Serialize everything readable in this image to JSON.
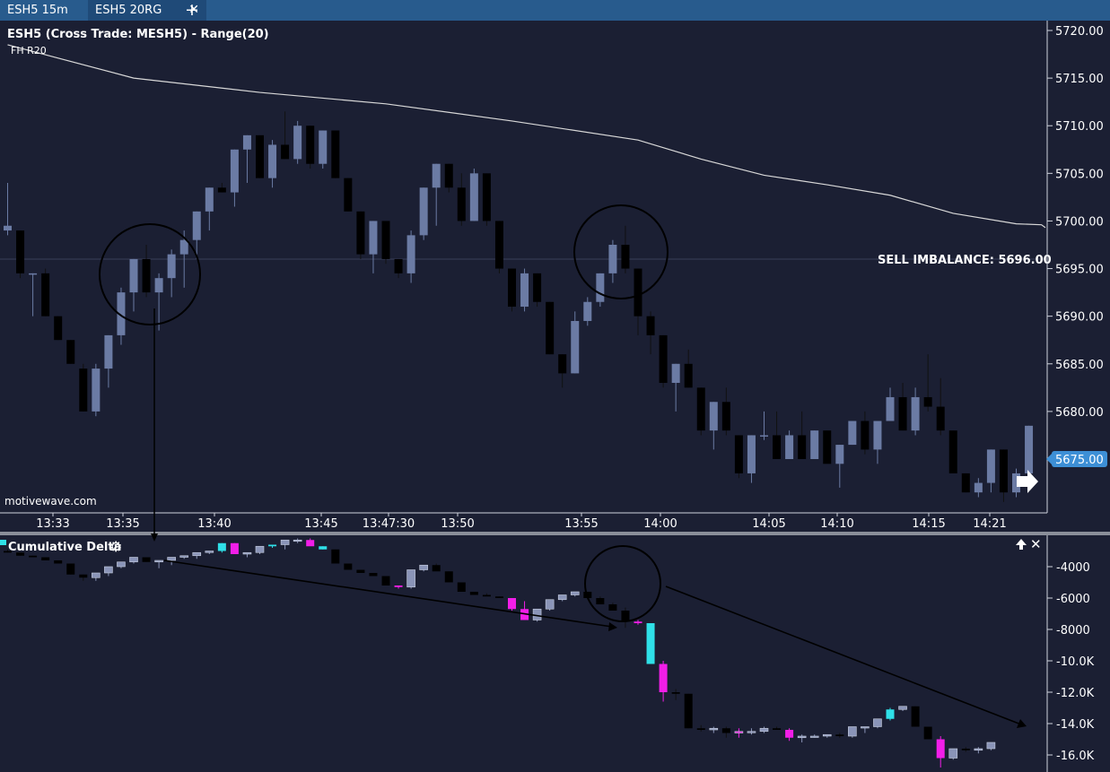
{
  "tabs": [
    {
      "label": "ESH5 15m",
      "active": false
    },
    {
      "label": "ESH5 20RG",
      "active": true
    }
  ],
  "add_tab_icon": "plus-icon",
  "close_tab_icon": "close-icon",
  "main": {
    "title": "ESH5 (Cross Trade: MESH5) - Range(20)",
    "subtitle": "FH R20",
    "watermark": "motivewave.com",
    "annotation": "SELL IMBALANCE: 5696.00",
    "current_price": "5675.00",
    "price_axis": [
      "5720.00",
      "5715.00",
      "5710.00",
      "5705.00",
      "5700.00",
      "5695.00",
      "5690.00",
      "5685.00",
      "5680.00",
      "5675.00"
    ],
    "time_axis": [
      "13:33",
      "13:35",
      "13:40",
      "13:45",
      "13:47:30",
      "13:50",
      "13:55",
      "14:00",
      "14:05",
      "14:10",
      "14:15",
      "14:21"
    ]
  },
  "lower": {
    "title": "Cumulative Delta",
    "settings_icon": "gear-icon",
    "maximize_icon": "arrow-up-icon",
    "close_icon": "close-icon",
    "axis": [
      "-4000",
      "-6000",
      "-8000",
      "-10.0K",
      "-12.0K",
      "-14.0K",
      "-16.0K"
    ]
  },
  "colors": {
    "background": "#1b1f33",
    "up_candle": "#6b7ba4",
    "down_candle": "#000000",
    "delta_up": "#2fe0e8",
    "delta_down": "#f21ee8",
    "vwap_line": "#d8d8d8",
    "price_badge": "#3d8fd6"
  },
  "chart_data": [
    {
      "type": "candlestick",
      "title": "ESH5 (Cross Trade: MESH5) - Range(20)",
      "y_range": [
        5670,
        5722
      ],
      "x_labels": [
        "13:33",
        "13:35",
        "13:40",
        "13:45",
        "13:47:30",
        "13:50",
        "13:55",
        "14:00",
        "14:05",
        "14:10",
        "14:15",
        "14:21"
      ],
      "ohlc": [
        [
          5699.0,
          5704.0,
          5698.5,
          5699.5
        ],
        [
          5699.0,
          5699.0,
          5694.0,
          5694.5
        ],
        [
          5694.5,
          5694.5,
          5690.0,
          5694.5
        ],
        [
          5694.5,
          5695.0,
          5690.0,
          5690.0
        ],
        [
          5690.0,
          5690.0,
          5687.5,
          5687.5
        ],
        [
          5687.5,
          5687.5,
          5685.0,
          5685.0
        ],
        [
          5684.5,
          5685.0,
          5680.0,
          5680.0
        ],
        [
          5680.0,
          5685.0,
          5679.5,
          5684.5
        ],
        [
          5684.5,
          5688.0,
          5682.5,
          5688.0
        ],
        [
          5688.0,
          5693.0,
          5687.0,
          5692.5
        ],
        [
          5692.5,
          5696.0,
          5690.5,
          5696.0
        ],
        [
          5696.0,
          5697.5,
          5692.0,
          5692.5
        ],
        [
          5692.5,
          5694.5,
          5688.5,
          5694.0
        ],
        [
          5694.0,
          5697.0,
          5692.0,
          5696.5
        ],
        [
          5696.5,
          5699.0,
          5693.0,
          5698.0
        ],
        [
          5698.0,
          5701.0,
          5696.0,
          5701.0
        ],
        [
          5701.0,
          5703.5,
          5699.0,
          5703.5
        ],
        [
          5703.5,
          5704.0,
          5703.0,
          5703.0
        ],
        [
          5703.0,
          5707.5,
          5701.5,
          5707.5
        ],
        [
          5707.5,
          5709.0,
          5704.0,
          5709.0
        ],
        [
          5709.0,
          5709.0,
          5704.5,
          5704.5
        ],
        [
          5704.5,
          5708.5,
          5703.5,
          5708.0
        ],
        [
          5708.0,
          5711.5,
          5706.5,
          5706.5
        ],
        [
          5706.5,
          5710.5,
          5706.0,
          5710.0
        ],
        [
          5710.0,
          5710.0,
          5705.5,
          5706.0
        ],
        [
          5706.0,
          5709.5,
          5705.5,
          5709.5
        ],
        [
          5709.5,
          5709.5,
          5704.5,
          5704.5
        ],
        [
          5704.5,
          5704.5,
          5701.0,
          5701.0
        ],
        [
          5701.0,
          5701.0,
          5696.0,
          5696.5
        ],
        [
          5696.5,
          5700.0,
          5694.5,
          5700.0
        ],
        [
          5700.0,
          5700.0,
          5695.5,
          5696.0
        ],
        [
          5696.0,
          5696.0,
          5694.0,
          5694.5
        ],
        [
          5694.5,
          5699.0,
          5693.5,
          5698.5
        ],
        [
          5698.5,
          5703.5,
          5698.0,
          5703.5
        ],
        [
          5703.5,
          5706.0,
          5699.5,
          5706.0
        ],
        [
          5706.0,
          5706.0,
          5703.0,
          5703.5
        ],
        [
          5703.5,
          5705.0,
          5699.5,
          5700.0
        ],
        [
          5700.0,
          5705.5,
          5700.0,
          5705.0
        ],
        [
          5705.0,
          5705.0,
          5699.5,
          5700.0
        ],
        [
          5700.0,
          5700.0,
          5694.5,
          5695.0
        ],
        [
          5695.0,
          5695.0,
          5690.5,
          5691.0
        ],
        [
          5691.0,
          5695.0,
          5690.5,
          5694.5
        ],
        [
          5694.5,
          5694.5,
          5691.0,
          5691.5
        ],
        [
          5691.5,
          5691.5,
          5686.0,
          5686.0
        ],
        [
          5686.0,
          5686.0,
          5682.5,
          5684.0
        ],
        [
          5684.0,
          5690.5,
          5684.0,
          5689.5
        ],
        [
          5689.5,
          5692.0,
          5689.0,
          5691.5
        ],
        [
          5691.5,
          5694.5,
          5691.0,
          5694.5
        ],
        [
          5694.5,
          5698.0,
          5693.5,
          5697.5
        ],
        [
          5697.5,
          5699.5,
          5694.5,
          5695.0
        ],
        [
          5695.0,
          5695.0,
          5688.0,
          5690.0
        ],
        [
          5690.0,
          5690.5,
          5686.0,
          5688.0
        ],
        [
          5688.0,
          5688.0,
          5682.5,
          5683.0
        ],
        [
          5683.0,
          5685.0,
          5680.0,
          5685.0
        ],
        [
          5685.0,
          5686.5,
          5682.5,
          5682.5
        ],
        [
          5682.5,
          5682.5,
          5677.5,
          5678.0
        ],
        [
          5678.0,
          5681.0,
          5676.0,
          5681.0
        ],
        [
          5681.0,
          5682.5,
          5677.5,
          5678.0
        ],
        [
          5677.5,
          5677.5,
          5673.0,
          5673.5
        ],
        [
          5673.5,
          5677.5,
          5672.5,
          5677.5
        ],
        [
          5677.5,
          5680.0,
          5677.0,
          5677.5
        ],
        [
          5677.5,
          5680.0,
          5676.5,
          5675.0
        ],
        [
          5675.0,
          5678.0,
          5675.0,
          5677.5
        ],
        [
          5677.5,
          5680.0,
          5675.0,
          5675.0
        ],
        [
          5675.0,
          5678.0,
          5675.0,
          5678.0
        ],
        [
          5678.0,
          5678.0,
          5675.0,
          5674.5
        ],
        [
          5674.5,
          5676.5,
          5672.0,
          5676.5
        ],
        [
          5676.5,
          5679.0,
          5676.5,
          5679.0
        ],
        [
          5679.0,
          5680.0,
          5675.5,
          5676.0
        ],
        [
          5676.0,
          5679.0,
          5674.5,
          5679.0
        ],
        [
          5679.0,
          5682.5,
          5679.0,
          5681.5
        ],
        [
          5681.5,
          5683.0,
          5678.0,
          5678.0
        ],
        [
          5678.0,
          5682.5,
          5677.5,
          5681.5
        ],
        [
          5681.5,
          5686.0,
          5680.0,
          5680.5
        ],
        [
          5680.5,
          5683.5,
          5677.5,
          5678.0
        ],
        [
          5678.0,
          5678.0,
          5675.5,
          5673.5
        ],
        [
          5673.5,
          5673.5,
          5671.5,
          5671.5
        ],
        [
          5671.5,
          5673.0,
          5671.0,
          5672.5
        ],
        [
          5672.5,
          5676.0,
          5671.5,
          5676.0
        ],
        [
          5676.0,
          5676.0,
          5670.5,
          5671.5
        ],
        [
          5671.5,
          5674.0,
          5671.0,
          5673.5
        ],
        [
          5673.5,
          5678.5,
          5673.0,
          5678.5
        ]
      ],
      "vwap": [
        [
          0,
          5718.5
        ],
        [
          10,
          5715.0
        ],
        [
          20,
          5713.5
        ],
        [
          30,
          5712.3
        ],
        [
          40,
          5710.5
        ],
        [
          50,
          5708.5
        ],
        [
          55,
          5706.5
        ],
        [
          60,
          5704.8
        ],
        [
          65,
          5703.8
        ],
        [
          70,
          5702.7
        ],
        [
          75,
          5700.8
        ],
        [
          80,
          5699.7
        ],
        [
          82,
          5699.6
        ]
      ],
      "annotations": [
        {
          "text": "SELL IMBALANCE: 5696.00",
          "price": 5696.0
        }
      ]
    },
    {
      "type": "candlestick",
      "title": "Cumulative Delta",
      "y_range": [
        -17000,
        -2800
      ],
      "ohlc": [
        [
          -3000,
          -2900,
          -3100,
          -3100
        ],
        [
          -3100,
          -3100,
          -3300,
          -3300
        ],
        [
          -3300,
          -3300,
          -3400,
          -3400
        ],
        [
          -3400,
          -3400,
          -3600,
          -3600
        ],
        [
          -3600,
          -3600,
          -3800,
          -3800
        ],
        [
          -3800,
          -3800,
          -4500,
          -4500
        ],
        [
          -4500,
          -4500,
          -4900,
          -4700
        ],
        [
          -4700,
          -4700,
          -4900,
          -4400
        ],
        [
          -4400,
          -4300,
          -4600,
          -4000
        ],
        [
          -4000,
          -3900,
          -4100,
          -3700
        ],
        [
          -3700,
          -3600,
          -3800,
          -3400
        ],
        [
          -3400,
          -3400,
          -3700,
          -3700
        ],
        [
          -3700,
          -3600,
          -4100,
          -3600
        ],
        [
          -3600,
          -3400,
          -3900,
          -3400
        ],
        [
          -3400,
          -3300,
          -3500,
          -3300
        ],
        [
          -3300,
          -3200,
          -3500,
          -3100
        ],
        [
          -3100,
          -3000,
          -3200,
          -3000
        ],
        [
          -3000,
          -2500,
          -3100,
          -2500
        ],
        [
          -2500,
          -2500,
          -3100,
          -3200
        ],
        [
          -3200,
          -3200,
          -3400,
          -3100
        ],
        [
          -3100,
          -2900,
          -3200,
          -2700
        ],
        [
          -2700,
          -2600,
          -2800,
          -2600
        ],
        [
          -2600,
          -2400,
          -2900,
          -2300
        ],
        [
          -2300,
          -2200,
          -2500,
          -2300
        ],
        [
          -2300,
          -2200,
          -2500,
          -2700
        ],
        [
          -2700,
          -2700,
          -2900,
          -2900
        ],
        [
          -2900,
          -2900,
          -3800,
          -3800
        ],
        [
          -3800,
          -3800,
          -4200,
          -4200
        ],
        [
          -4200,
          -4200,
          -4400,
          -4400
        ],
        [
          -4400,
          -4400,
          -4600,
          -4600
        ],
        [
          -4600,
          -4600,
          -5200,
          -5200
        ],
        [
          -5200,
          -5200,
          -5400,
          -5300
        ],
        [
          -5300,
          -5200,
          -5400,
          -4200
        ],
        [
          -4200,
          -4000,
          -4300,
          -3900
        ],
        [
          -3900,
          -3800,
          -4000,
          -4300
        ],
        [
          -4300,
          -4300,
          -5000,
          -5000
        ],
        [
          -5000,
          -5000,
          -5600,
          -5600
        ],
        [
          -5600,
          -5600,
          -5800,
          -5800
        ],
        [
          -5800,
          -5700,
          -5800,
          -5900
        ],
        [
          -5900,
          -5900,
          -6000,
          -6000
        ],
        [
          -6000,
          -6000,
          -6800,
          -6700
        ],
        [
          -6700,
          -6200,
          -7400,
          -7400
        ],
        [
          -7400,
          -7300,
          -7500,
          -6700
        ],
        [
          -6700,
          -6100,
          -6800,
          -6100
        ],
        [
          -6100,
          -5800,
          -6200,
          -5800
        ],
        [
          -5800,
          -5600,
          -5900,
          -5600
        ],
        [
          -5600,
          -5600,
          -6100,
          -6000
        ],
        [
          -6000,
          -5900,
          -6400,
          -6400
        ],
        [
          -6400,
          -6300,
          -6800,
          -6800
        ],
        [
          -6800,
          -6600,
          -7900,
          -7500
        ],
        [
          -7500,
          -7400,
          -7700,
          -7600
        ],
        [
          -7600,
          -7600,
          -10200,
          -10200
        ],
        [
          -10200,
          -10000,
          -12600,
          -12000
        ],
        [
          -12000,
          -11800,
          -12500,
          -12100
        ],
        [
          -12100,
          -12100,
          -14300,
          -14300
        ],
        [
          -14300,
          -14100,
          -14500,
          -14400
        ],
        [
          -14400,
          -14200,
          -14600,
          -14300
        ],
        [
          -14300,
          -14200,
          -14900,
          -14600
        ],
        [
          -14600,
          -14300,
          -14900,
          -14500
        ],
        [
          -14500,
          -14300,
          -14700,
          -14500
        ],
        [
          -14500,
          -14200,
          -14600,
          -14300
        ],
        [
          -14300,
          -14200,
          -14400,
          -14400
        ],
        [
          -14400,
          -14300,
          -15100,
          -14900
        ],
        [
          -14900,
          -14700,
          -15200,
          -14800
        ],
        [
          -14800,
          -14700,
          -14900,
          -14800
        ],
        [
          -14800,
          -14700,
          -14900,
          -14700
        ],
        [
          -14700,
          -14600,
          -14900,
          -14800
        ],
        [
          -14800,
          -14700,
          -14900,
          -14200
        ],
        [
          -14200,
          -14200,
          -14600,
          -14200
        ],
        [
          -14200,
          -14100,
          -14300,
          -13700
        ],
        [
          -13700,
          -13000,
          -13800,
          -13100
        ],
        [
          -13100,
          -12900,
          -13200,
          -12900
        ],
        [
          -12900,
          -12900,
          -14200,
          -14200
        ],
        [
          -14200,
          -14200,
          -15000,
          -15000
        ],
        [
          -15000,
          -14800,
          -16800,
          -16200
        ],
        [
          -16200,
          -15800,
          -16300,
          -15600
        ],
        [
          -15600,
          -15500,
          -15800,
          -15700
        ],
        [
          -15700,
          -15500,
          -15900,
          -15600
        ],
        [
          -15600,
          -15200,
          -15700,
          -15200
        ]
      ],
      "highlight_colors": {
        "up": [
          17,
          21,
          25,
          51,
          70
        ],
        "down": [
          18,
          24,
          31,
          40,
          41,
          50,
          52,
          58,
          62,
          74
        ]
      }
    }
  ]
}
